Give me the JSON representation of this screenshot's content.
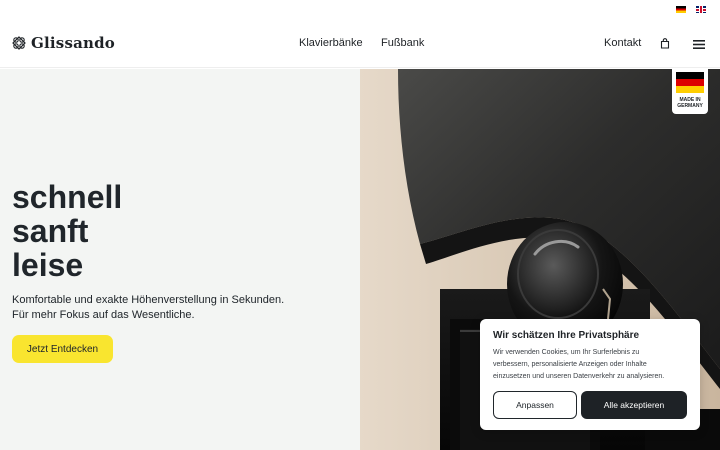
{
  "languages": [
    {
      "code": "de",
      "icon": "flag-de-icon"
    },
    {
      "code": "en",
      "icon": "flag-en-icon"
    }
  ],
  "brand": {
    "name": "Glissando",
    "icon": "logo-icon"
  },
  "nav": {
    "items": [
      "Klavierbänke",
      "Fußbank"
    ],
    "contact": "Kontakt",
    "cart_icon": "shopping-bag-icon",
    "menu_icon": "hamburger-menu-icon"
  },
  "hero": {
    "title_lines": [
      "schnell",
      "sanft",
      "leise"
    ],
    "description_lines": [
      "Komfortable und exakte Höhenverstellung in Sekunden.",
      "Für mehr Fokus auf das Wesentliche."
    ],
    "cta": "Jetzt Entdecken",
    "badge_lines": [
      "MADE IN",
      "GERMANY"
    ]
  },
  "cookie": {
    "title": "Wir schätzen Ihre Privatsphäre",
    "text_lines": [
      "Wir verwenden Cookies, um Ihr Surferlebnis zu",
      "verbessern, personalisierte Anzeigen oder Inhalte",
      "einzusetzen und unseren Datenverkehr zu analysieren."
    ],
    "customize": "Anpassen",
    "accept_all": "Alle akzeptieren"
  },
  "colors": {
    "accent": "#f9e52f",
    "dark": "#1e2226",
    "hero_bg": "#f3f5f3"
  }
}
